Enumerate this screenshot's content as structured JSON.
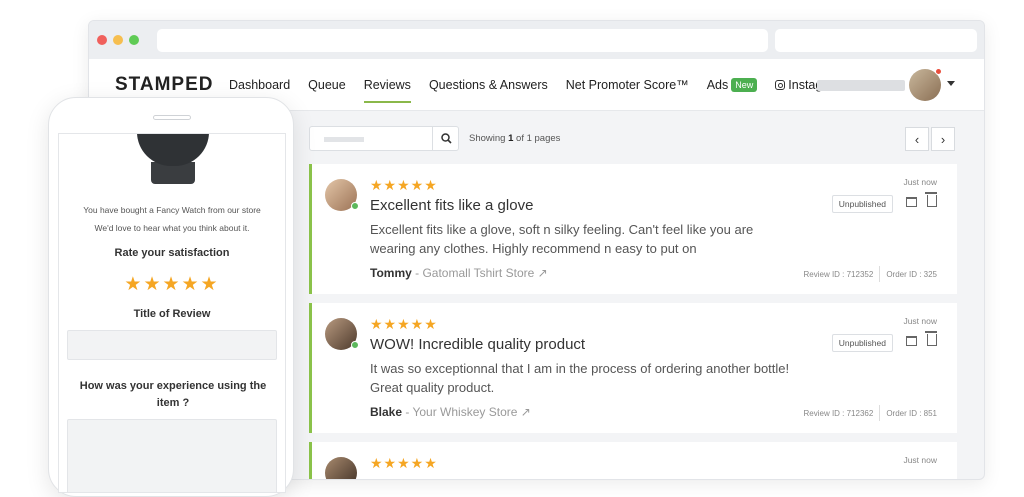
{
  "nav": {
    "logo": "STAMPED",
    "items": [
      "Dashboard",
      "Queue",
      "Reviews",
      "Questions & Answers",
      "Net Promoter Score™",
      "Ads"
    ],
    "new_badge": "New",
    "instagram": "Instagram"
  },
  "toolbar": {
    "showing_prefix": "Showing ",
    "showing_count": "1",
    "showing_suffix": " of 1 pages",
    "prev": "‹",
    "next": "›"
  },
  "reviews": [
    {
      "stars": "★★★★★",
      "title": "Excellent fits like a glove",
      "body": "Excellent fits like a glove, soft n silky feeling. Can't feel like you are wearing any clothes. Highly recommend n easy to put on",
      "author": "Tommy",
      "store": " - Gatomall Tshirt Store ↗",
      "time": "Just now",
      "status": "Unpublished",
      "review_id": "Review ID : 712352",
      "order_id": "Order ID : 325"
    },
    {
      "stars": "★★★★★",
      "title": "WOW! Incredible quality product",
      "body": "It was so exceptionnal that I am in the process of ordering another bottle! Great quality product.",
      "author": "Blake",
      "store": " - Your Whiskey Store ↗",
      "time": "Just now",
      "status": "Unpublished",
      "review_id": "Review ID : 712362",
      "order_id": "Order ID : 851"
    },
    {
      "stars": "★★★★★",
      "time": "Just now"
    }
  ],
  "phone": {
    "line1": "You have bought a Fancy Watch from our store",
    "line2": "We'd love to hear what you think about it.",
    "rate_label": "Rate your satisfaction",
    "stars": "★★★★★",
    "title_label": "Title of Review",
    "question": "How was your experience using the item ?"
  },
  "colors": {
    "accent_green": "#8bc34a",
    "star": "#f5a623",
    "new_badge": "#4caf50"
  }
}
